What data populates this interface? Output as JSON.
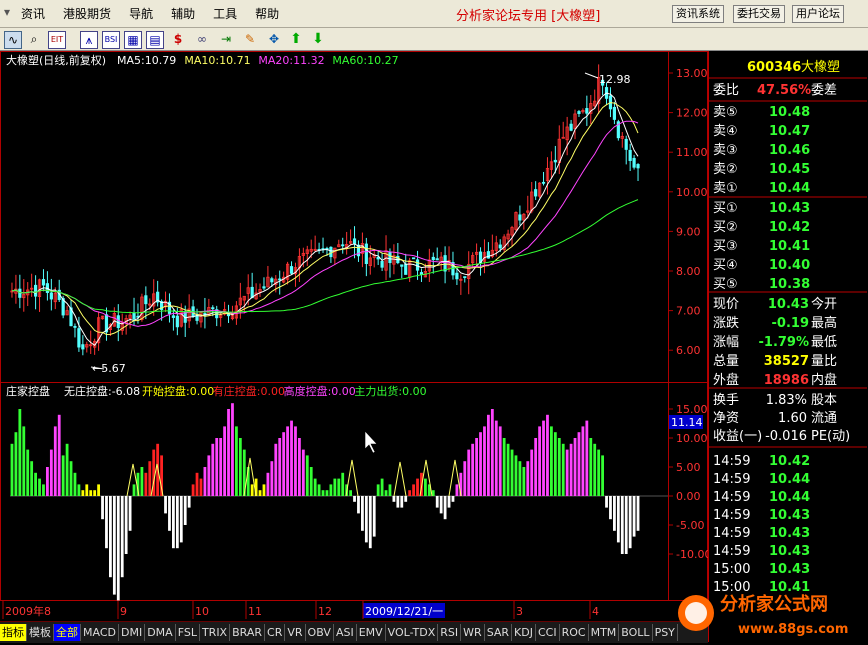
{
  "menu": {
    "items": [
      "资讯",
      "港股期货",
      "导航",
      "辅助",
      "工具",
      "帮助"
    ],
    "brand": "分析家论坛专用 [大橡塑]",
    "buttons": [
      "资讯系统",
      "委托交易",
      "用户论坛"
    ]
  },
  "toolbar_icons": [
    "chart-icon",
    "zoom-icon",
    "exit-icon",
    "kline-icon",
    "bsi-icon",
    "window-icon",
    "dollar-icon",
    "link-icon",
    "export-icon",
    "pencil-icon",
    "move-icon",
    "up-arrow-icon",
    "down-arrow-icon"
  ],
  "main_chart": {
    "title": "大橡塑(日线,前复权)",
    "ma": [
      {
        "label": "MA5:10.79",
        "color": "#ffffff"
      },
      {
        "label": "MA10:10.71",
        "color": "#ffff66"
      },
      {
        "label": "MA20:11.32",
        "color": "#ff44ff"
      },
      {
        "label": "MA60:10.27",
        "color": "#33ff33"
      }
    ],
    "y_ticks": [
      "13.00",
      "12.00",
      "11.00",
      "10.00",
      "9.00",
      "8.00",
      "7.00",
      "6.00"
    ],
    "high_label": "12.98",
    "low_label": "5.67"
  },
  "indicator": {
    "title": "庄家控盘",
    "items": [
      {
        "label": "无庄控盘:-6.08",
        "color": "#ffffff"
      },
      {
        "label": "开始控盘:0.00",
        "color": "#ffff00"
      },
      {
        "label": "有庄控盘:0.00",
        "color": "#ff2222"
      },
      {
        "label": "高度控盘:0.00",
        "color": "#ff44ff"
      },
      {
        "label": "主力出货:0.00",
        "color": "#33ff33"
      }
    ],
    "y_ticks": [
      "15.00",
      "10.00",
      "5.00",
      "0.00",
      "-5.00",
      "-10.00"
    ],
    "marker": "11.14"
  },
  "x_axis": {
    "labels": [
      "2009年8",
      "9",
      "10",
      "11",
      "12",
      "2009/12/21/一",
      "3",
      "4"
    ]
  },
  "bottom_tabs": [
    "指标",
    "模板",
    "全部",
    "MACD",
    "DMI",
    "DMA",
    "FSL",
    "TRIX",
    "BRAR",
    "CR",
    "VR",
    "OBV",
    "ASI",
    "EMV",
    "VOL-TDX",
    "RSI",
    "WR",
    "SAR",
    "KDJ",
    "CCI",
    "ROC",
    "MTM",
    "BOLL",
    "PSY"
  ],
  "quote": {
    "code": "600346",
    "name": "大橡塑",
    "ratio_label": "委比",
    "ratio_value": "47.56%",
    "diff_label": "委差",
    "asks": [
      {
        "label": "卖⑤",
        "price": "10.48"
      },
      {
        "label": "卖④",
        "price": "10.47"
      },
      {
        "label": "卖③",
        "price": "10.46"
      },
      {
        "label": "卖②",
        "price": "10.45"
      },
      {
        "label": "卖①",
        "price": "10.44"
      }
    ],
    "bids": [
      {
        "label": "买①",
        "price": "10.43"
      },
      {
        "label": "买②",
        "price": "10.42"
      },
      {
        "label": "买③",
        "price": "10.41"
      },
      {
        "label": "买④",
        "price": "10.40"
      },
      {
        "label": "买⑤",
        "price": "10.38"
      }
    ],
    "stats": [
      {
        "l": "现价",
        "v": "10.43",
        "vc": "#33ff33",
        "r": "今开"
      },
      {
        "l": "涨跌",
        "v": "-0.19",
        "vc": "#33ff33",
        "r": "最高"
      },
      {
        "l": "涨幅",
        "v": "-1.79%",
        "vc": "#33ff33",
        "r": "最低"
      },
      {
        "l": "总量",
        "v": "38527",
        "vc": "#ffff00",
        "r": "量比"
      },
      {
        "l": "外盘",
        "v": "18986",
        "vc": "#ff3333",
        "r": "内盘"
      }
    ],
    "fund": [
      {
        "l": "换手",
        "v": "1.83%",
        "r": "股本"
      },
      {
        "l": "净资",
        "v": "1.60",
        "r": "流通"
      },
      {
        "l": "收益(一)",
        "v": "-0.016",
        "r": "PE(动)"
      }
    ],
    "ticks": [
      {
        "t": "14:59",
        "p": "10.42"
      },
      {
        "t": "14:59",
        "p": "10.44"
      },
      {
        "t": "14:59",
        "p": "10.44"
      },
      {
        "t": "14:59",
        "p": "10.43"
      },
      {
        "t": "14:59",
        "p": "10.43"
      },
      {
        "t": "14:59",
        "p": "10.43"
      },
      {
        "t": "15:00",
        "p": "10.43"
      },
      {
        "t": "15:00",
        "p": "10.41"
      }
    ]
  },
  "watermark": {
    "name": "分析家公式网",
    "url": "www.88gs.com"
  }
}
